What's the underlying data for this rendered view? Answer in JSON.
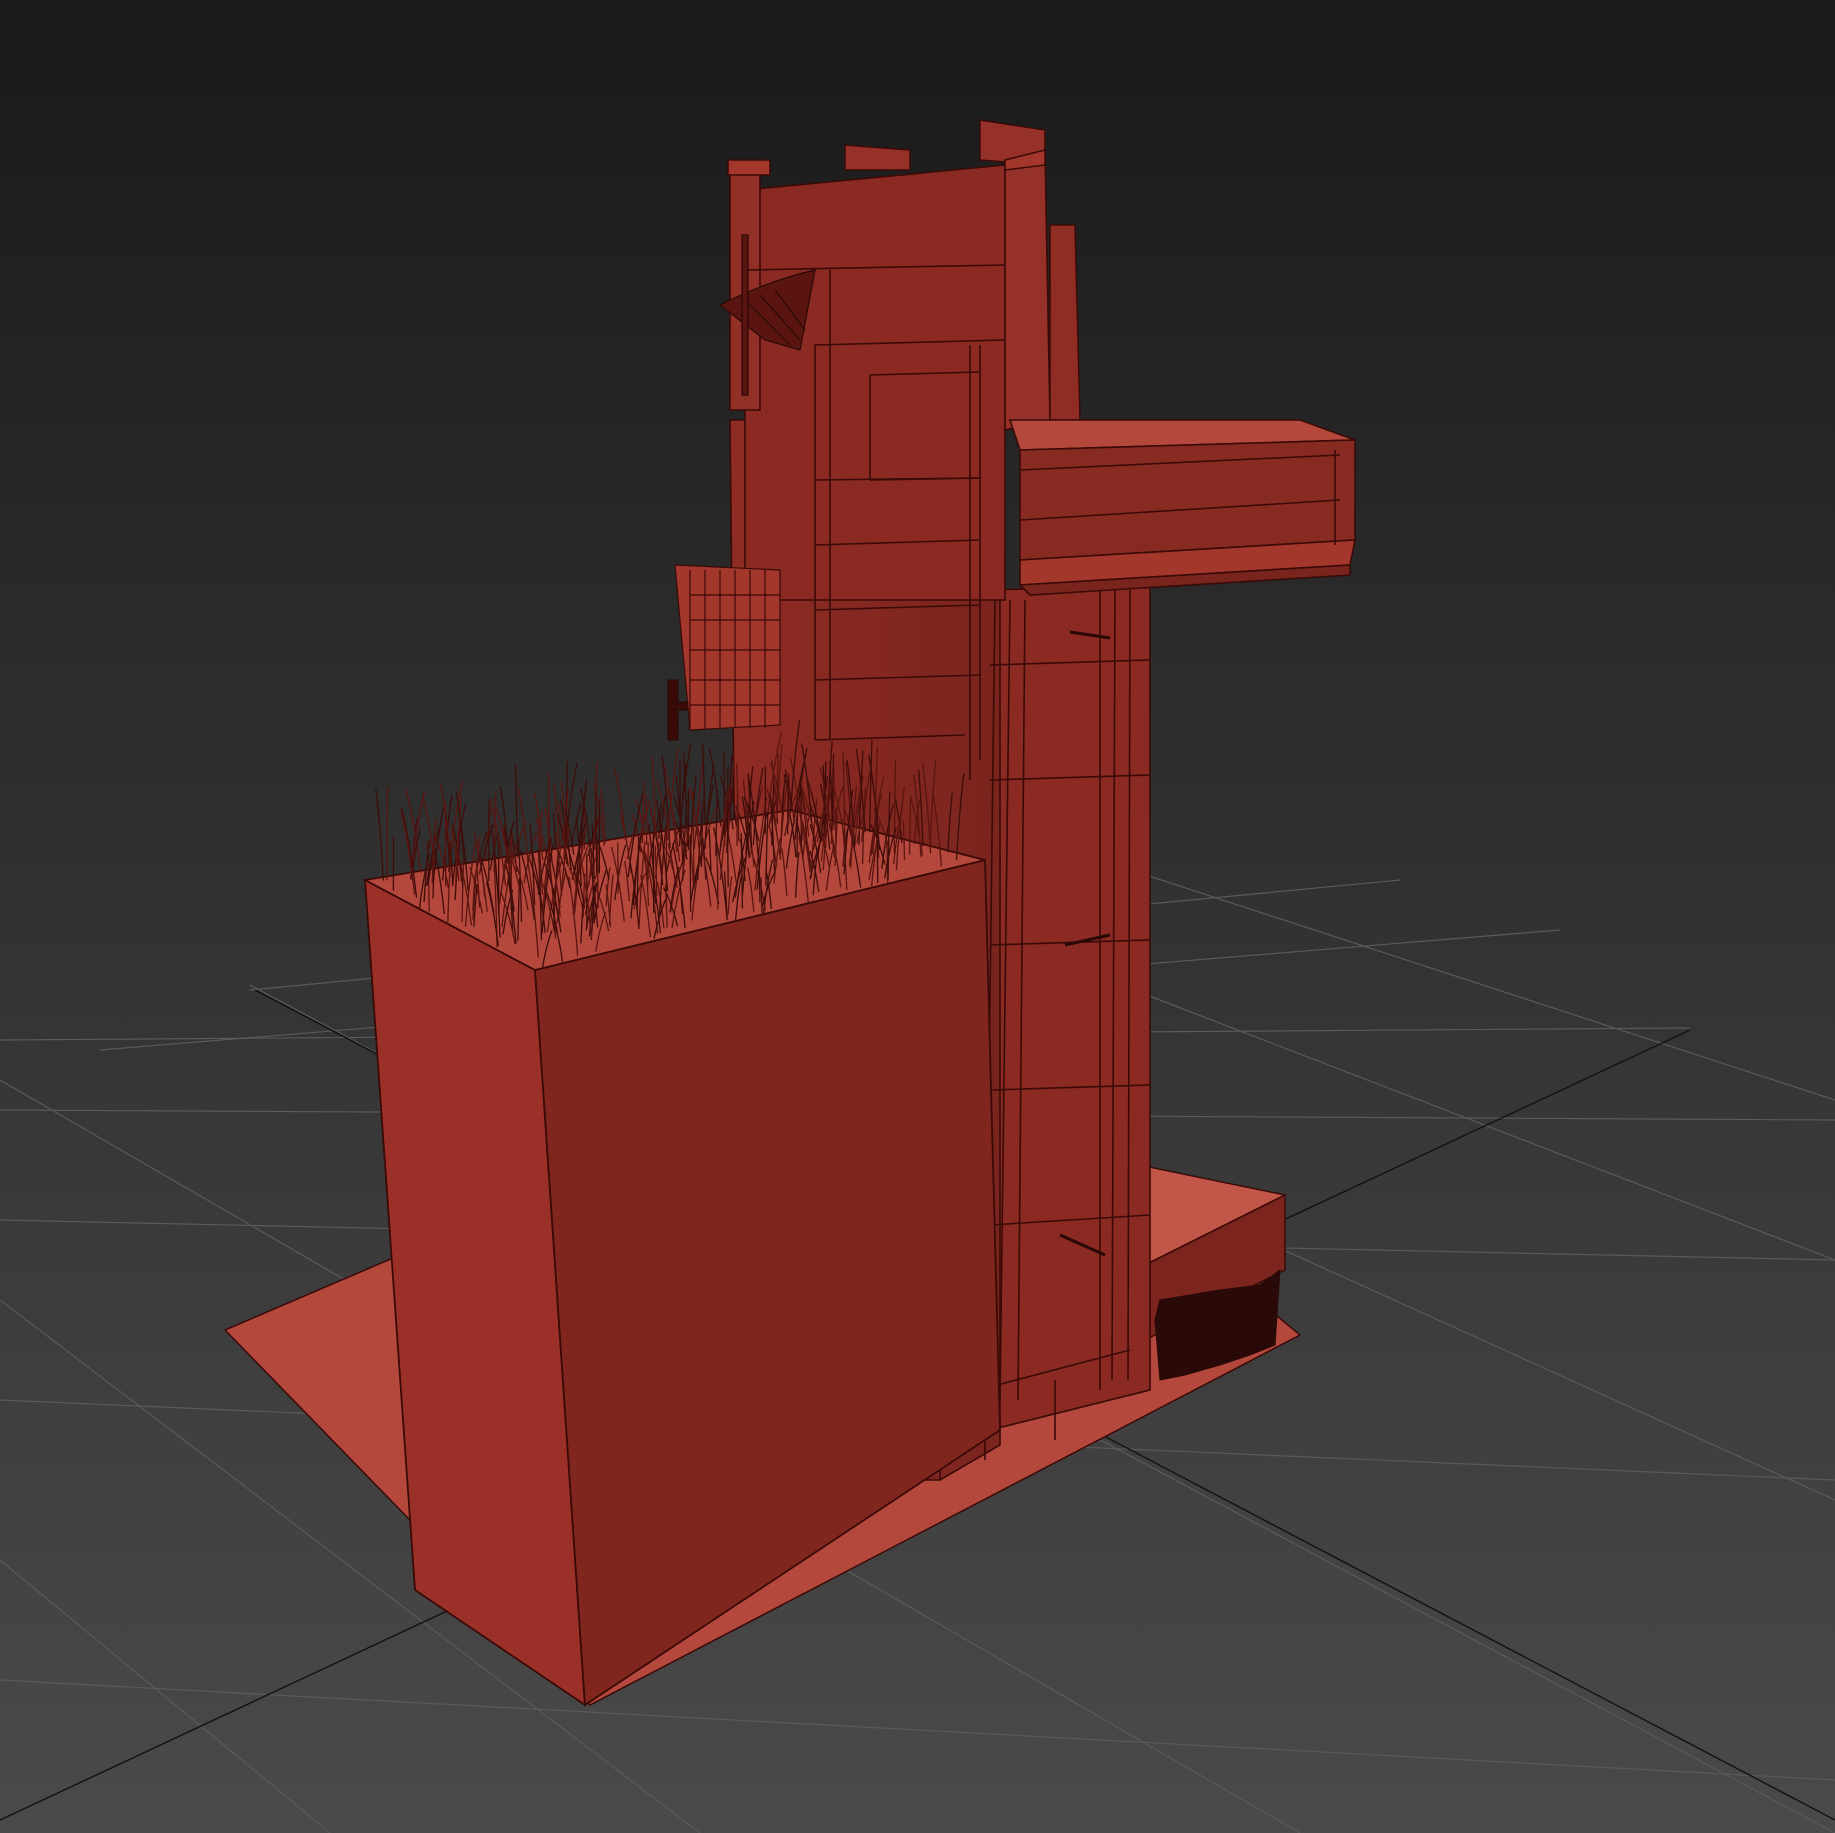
{
  "viewport": {
    "view": "perspective",
    "shading": "wireframe-over-shaded",
    "background_top": "#1c1c1c",
    "background_bottom": "#4a4a4a"
  },
  "grid": {
    "visible": true,
    "line_color": "#5c5c5c",
    "axis_color": "#111111"
  },
  "scene": {
    "object_color": "#832821",
    "object_highlight": "#a3372c",
    "object_light_face": "#c3584b",
    "wire_color": "#3a0a07",
    "grass_color": "#3c0d0a",
    "objects": [
      "ground-plate",
      "planter-box",
      "grass-patch",
      "main-tower",
      "cantilever-balcony",
      "crenellations",
      "vent-grille",
      "wall-handle",
      "sconce-lamp",
      "side-ladder",
      "rear-step-base",
      "rear-shrub"
    ]
  }
}
